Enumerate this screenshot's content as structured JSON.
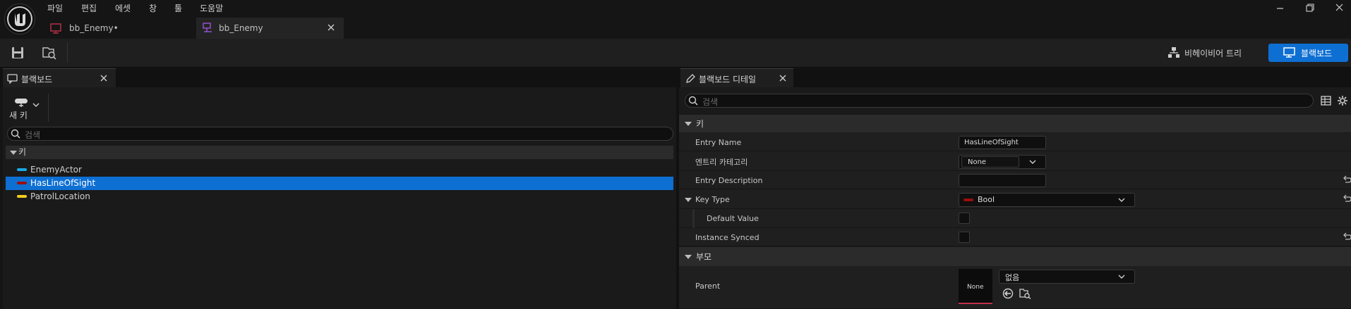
{
  "menu": [
    "파일",
    "편집",
    "에셋",
    "창",
    "툴",
    "도움말"
  ],
  "document_tabs": [
    {
      "label": "bb_Enemy•",
      "active": false
    },
    {
      "label": "bb_Enemy",
      "active": true
    }
  ],
  "toolbar": {
    "behavior_tree_label": "비헤이비어 트리",
    "blackboard_label": "블랙보드"
  },
  "left_panel": {
    "tab_label": "블랙보드",
    "new_key_label": "새 키",
    "search_placeholder": "검색",
    "category_label": "키",
    "keys": [
      {
        "name": "EnemyActor",
        "color": "#1aa8e6",
        "selected": false
      },
      {
        "name": "HasLineOfSight",
        "color": "#9b0e0e",
        "selected": true
      },
      {
        "name": "PatrolLocation",
        "color": "#f2cc1e",
        "selected": false
      }
    ]
  },
  "right_panel": {
    "tab_label": "블랙보드 디테일",
    "search_placeholder": "검색",
    "section_key_label": "키",
    "section_parent_label": "부모",
    "entry_name_label": "Entry Name",
    "entry_name_value": "HasLineOfSight",
    "entry_category_label": "엔트리 카테고리",
    "entry_category_value": "None",
    "entry_description_label": "Entry Description",
    "entry_description_value": "",
    "key_type_label": "Key Type",
    "key_type_value": "Bool",
    "key_type_color": "#9b0e0e",
    "default_value_label": "Default Value",
    "instance_synced_label": "Instance Synced",
    "parent_label": "Parent",
    "parent_thumb_label": "None",
    "parent_combo_value": "없음"
  },
  "colors": {
    "accent": "#0e6fd3",
    "selection": "#0e6fd3",
    "bb_icon": "#9a54d6",
    "bb_icon_unsaved": "#c0304a"
  }
}
